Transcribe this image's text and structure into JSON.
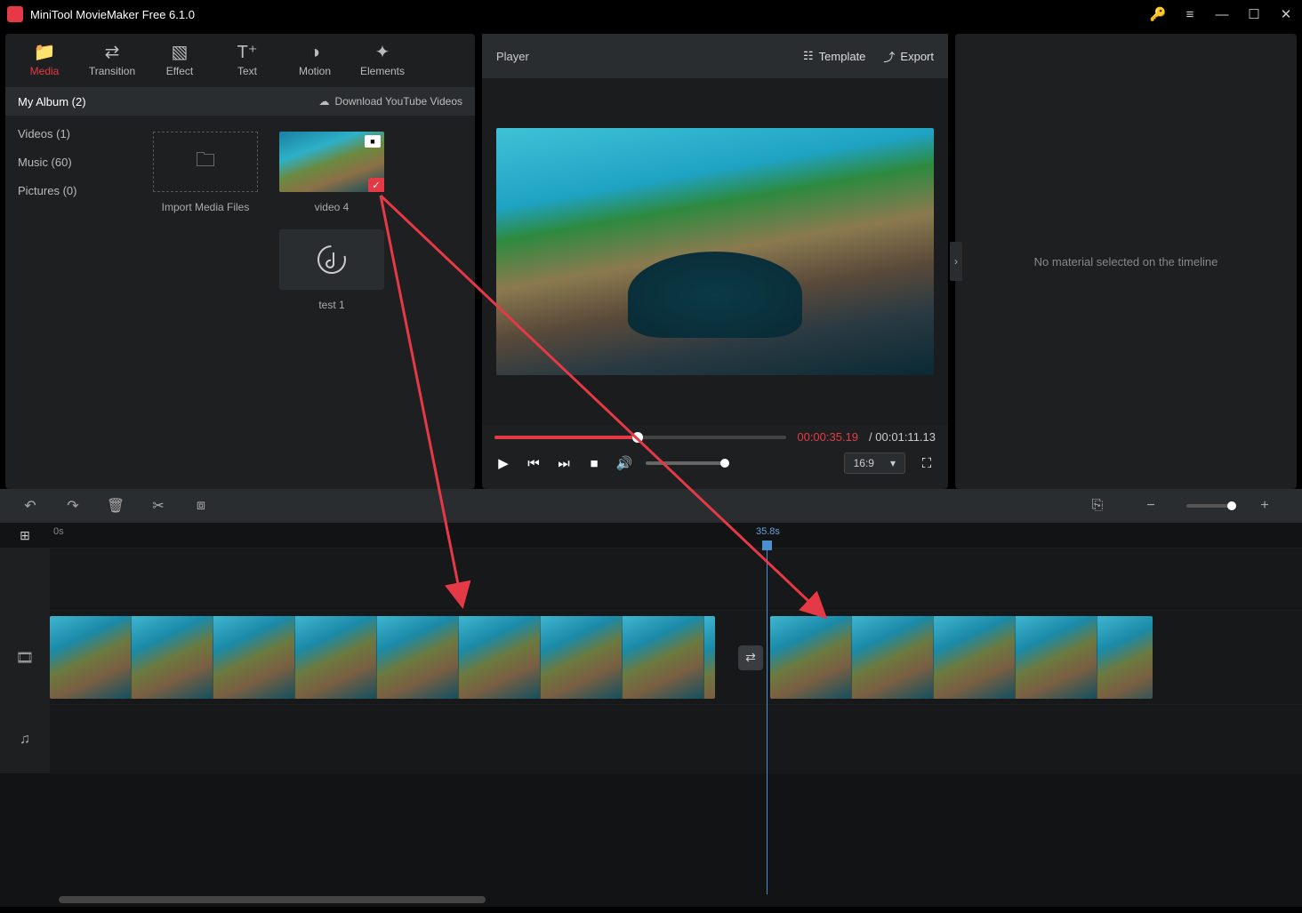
{
  "titlebar": {
    "title": "MiniTool MovieMaker Free 6.1.0"
  },
  "tabs": [
    {
      "label": "Media",
      "icon": "folder"
    },
    {
      "label": "Transition",
      "icon": "swap"
    },
    {
      "label": "Effect",
      "icon": "layers"
    },
    {
      "label": "Text",
      "icon": "text"
    },
    {
      "label": "Motion",
      "icon": "motion"
    },
    {
      "label": "Elements",
      "icon": "sparkle"
    }
  ],
  "sidebar": {
    "header": "My Album (2)",
    "download_label": "Download YouTube Videos",
    "items": [
      {
        "label": "Videos (1)"
      },
      {
        "label": "Music (60)"
      },
      {
        "label": "Pictures (0)"
      }
    ]
  },
  "media": {
    "import_label": "Import Media Files",
    "items": [
      {
        "label": "video 4",
        "type": "video",
        "checked": true
      },
      {
        "label": "test 1",
        "type": "audio"
      }
    ]
  },
  "player": {
    "title": "Player",
    "template_label": "Template",
    "export_label": "Export",
    "current_time": "00:00:35.19",
    "total_time": "00:01:11.13",
    "aspect": "16:9"
  },
  "right_panel": {
    "empty_text": "No material selected on the timeline"
  },
  "timeline": {
    "zero_label": "0s",
    "playhead_label": "35.8s"
  }
}
